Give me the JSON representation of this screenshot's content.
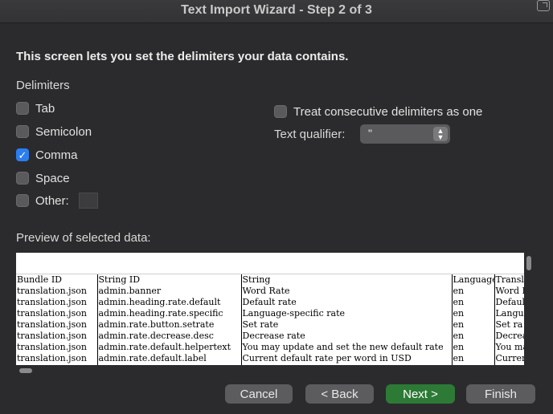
{
  "window": {
    "title": "Text Import Wizard - Step 2 of 3"
  },
  "instruction": "This screen lets you set the delimiters your data contains.",
  "delimiters": {
    "label": "Delimiters",
    "options": [
      {
        "label": "Tab",
        "checked": false
      },
      {
        "label": "Semicolon",
        "checked": false
      },
      {
        "label": "Comma",
        "checked": true
      },
      {
        "label": "Space",
        "checked": false
      },
      {
        "label": "Other:",
        "checked": false
      }
    ],
    "other_value": ""
  },
  "consecutive": {
    "label": "Treat consecutive delimiters as one",
    "checked": false
  },
  "qualifier": {
    "label": "Text qualifier:",
    "value": "\""
  },
  "preview": {
    "label": "Preview of selected data:",
    "rows": [
      [
        "Bundle ID",
        "String ID",
        "String",
        "Language",
        "Transl"
      ],
      [
        "translation.json",
        "admin.banner",
        "Word Rate",
        "en",
        "Word R"
      ],
      [
        "translation.json",
        "admin.heading.rate.default",
        "Default rate",
        "en",
        "Defaul"
      ],
      [
        "translation.json",
        "admin.heading.rate.specific",
        "Language-specific rate",
        "en",
        "Langua"
      ],
      [
        "translation.json",
        "admin.rate.button.setrate",
        "Set rate",
        "en",
        "Set ra"
      ],
      [
        "translation.json",
        "admin.rate.decrease.desc",
        "Decrease rate",
        "en",
        "Decrea"
      ],
      [
        "translation.json",
        "admin.rate.default.helpertext",
        "You may update and set the new default rate",
        "en",
        "You ma"
      ],
      [
        "translation.json",
        "admin.rate.default.label",
        "Current default rate per word in USD",
        "en",
        "Curren"
      ]
    ]
  },
  "buttons": {
    "cancel": "Cancel",
    "back": "< Back",
    "next": "Next >",
    "finish": "Finish"
  },
  "colors": {
    "accent": "#2a7ef0",
    "primary_button": "#2d7a36",
    "background": "#2b2b2d"
  }
}
